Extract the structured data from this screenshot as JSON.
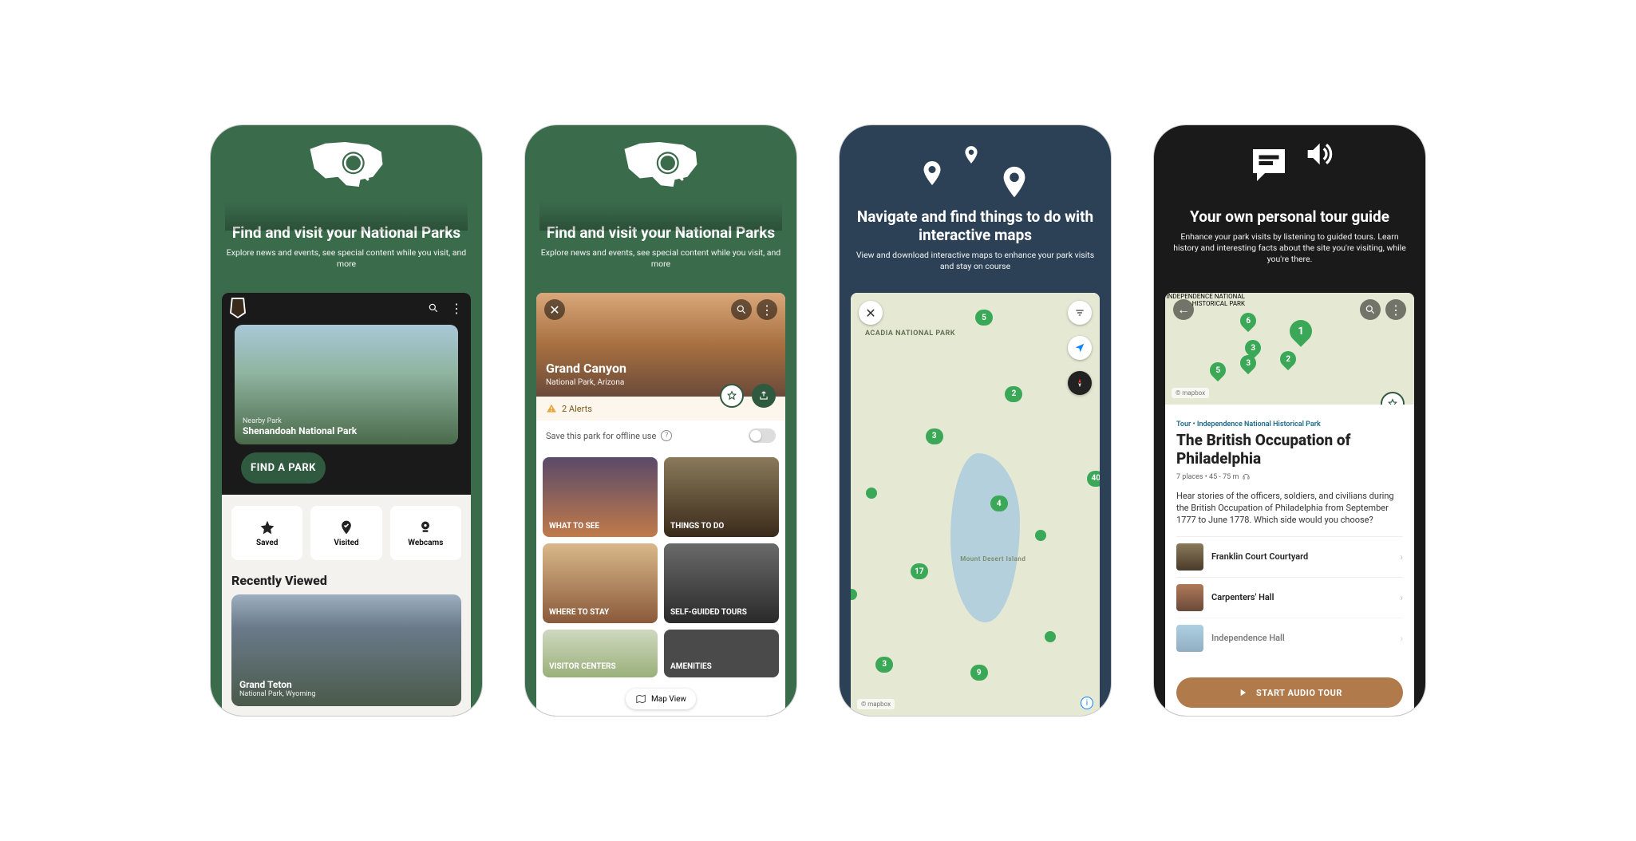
{
  "screen1": {
    "heading": "Find and visit your National Parks",
    "subhead": "Explore news and events, see special content while you visit, and more",
    "nearby_label": "Nearby Park",
    "nearby_park": "Shenandoah National Park",
    "find_button": "FIND A PARK",
    "tiles": {
      "saved": "Saved",
      "visited": "Visited",
      "webcams": "Webcams"
    },
    "recently_viewed_title": "Recently Viewed",
    "recent_park_name": "Grand Teton",
    "recent_park_sub": "National Park, Wyoming"
  },
  "screen2": {
    "heading": "Find and visit your National Parks",
    "subhead": "Explore news and events, see special content while you visit, and more",
    "park_name": "Grand Canyon",
    "park_sub": "National Park, Arizona",
    "alerts": "2 Alerts",
    "offline_label": "Save this park for offline use",
    "cards": {
      "what_to_see": "WHAT TO SEE",
      "things_to_do": "THINGS TO DO",
      "where_to_stay": "WHERE TO STAY",
      "self_guided": "SELF-GUIDED TOURS",
      "visitor_centers": "VISITOR CENTERS",
      "amenities": "AMENITIES"
    },
    "map_view": "Map View"
  },
  "screen3": {
    "heading": "Navigate and find things to do with interactive maps",
    "subhead": "View and download interactive maps to enhance your park visits and stay on course",
    "park_label": "ACADIA NATIONAL PARK",
    "island_label": "Mount Desert Island",
    "pins": [
      "5",
      "2",
      "3",
      "40",
      "4",
      "17",
      "3",
      "9"
    ],
    "attribution": "© mapbox"
  },
  "screen4": {
    "heading": "Your own personal tour guide",
    "subhead": "Enhance your park visits by listening to guided tours. Learn history and interesting facts about the site you're visiting, while you're there.",
    "map_pins": [
      "6",
      "1",
      "3",
      "2",
      "5",
      "3"
    ],
    "map_label": "INDEPENDENCE NATIONAL HISTORICAL PARK",
    "attribution": "© mapbox",
    "crumb": "Tour • Independence National Historical Park",
    "title": "The British Occupation of Philadelphia",
    "meta": "7 places • 45 - 75 m",
    "description": "Hear stories of the officers, soldiers, and civilians during the British Occupation of Philadelphia from September 1777 to June 1778. Which side would you choose?",
    "stops": [
      "Franklin Court Courtyard",
      "Carpenters' Hall",
      "Independence Hall"
    ],
    "audio_button": "START AUDIO TOUR"
  }
}
